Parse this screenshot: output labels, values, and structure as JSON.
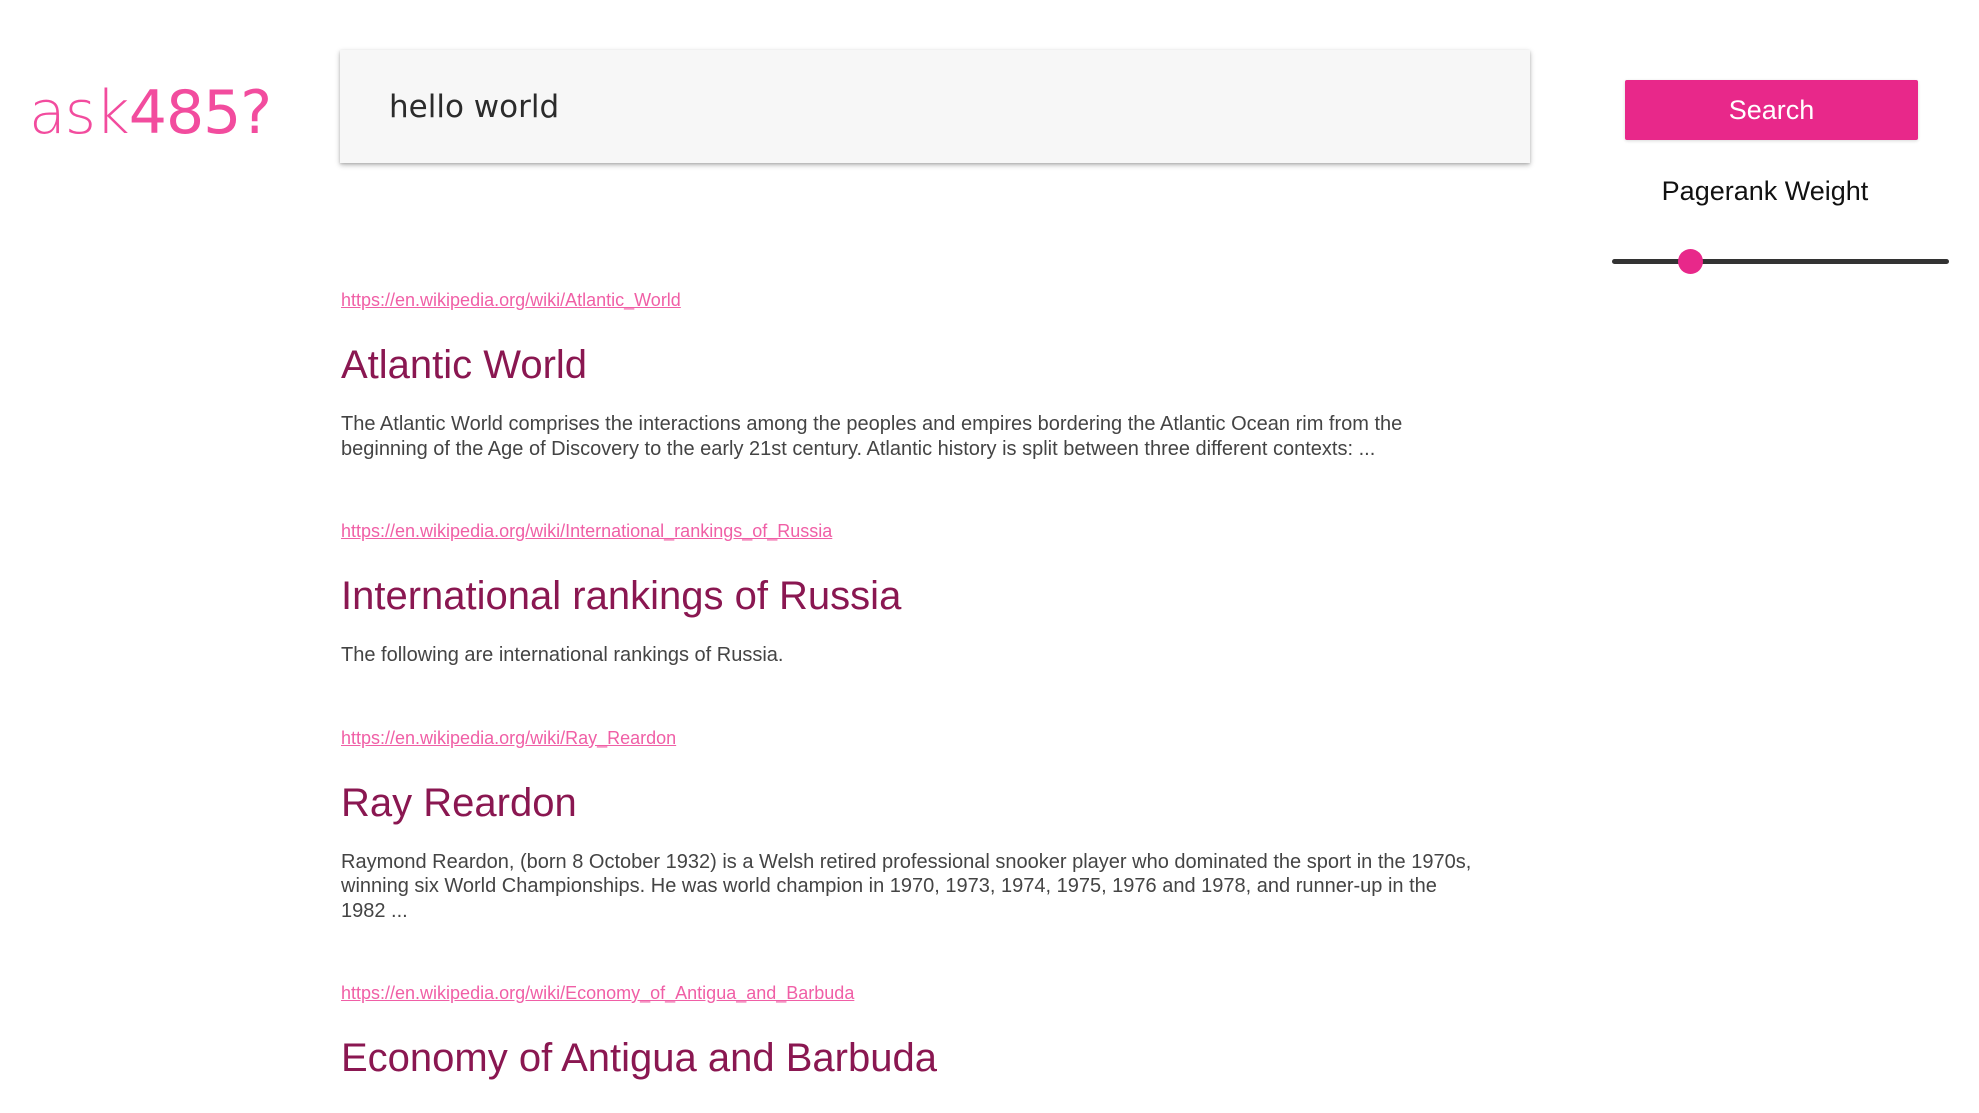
{
  "logo": {
    "prefix": "ask",
    "suffix": "485?"
  },
  "search": {
    "value": "hello world",
    "button_label": "Search"
  },
  "pagerank": {
    "label": "Pagerank Weight",
    "value_fraction": 0.23
  },
  "colors": {
    "accent": "#e8288a",
    "title": "#8a1751",
    "link": "#f05fa6",
    "logo": "#f24c9e"
  },
  "results": [
    {
      "url": "https://en.wikipedia.org/wiki/Atlantic_World",
      "title": "Atlantic World",
      "snippet": "The Atlantic World comprises the interactions among the peoples and empires bordering the Atlantic Ocean rim from the beginning of the Age of Discovery to the early 21st century. Atlantic history is split between three different contexts: ..."
    },
    {
      "url": "https://en.wikipedia.org/wiki/International_rankings_of_Russia",
      "title": "International rankings of Russia",
      "snippet": "The following are international rankings of Russia."
    },
    {
      "url": "https://en.wikipedia.org/wiki/Ray_Reardon",
      "title": "Ray Reardon",
      "snippet": "Raymond Reardon, (born 8 October 1932) is a Welsh retired professional snooker player who dominated the sport in the 1970s, winning six World Championships. He was world champion in 1970, 1973, 1974, 1975, 1976 and 1978, and runner-up in the 1982 ..."
    },
    {
      "url": "https://en.wikipedia.org/wiki/Economy_of_Antigua_and_Barbuda",
      "title": "Economy of Antigua and Barbuda",
      "snippet": ""
    }
  ]
}
